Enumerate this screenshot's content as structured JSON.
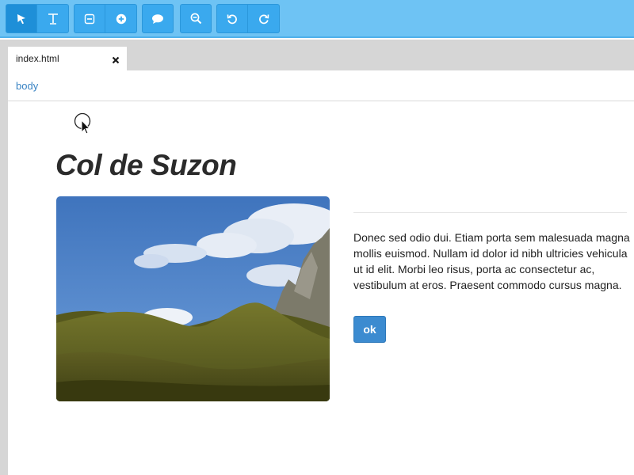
{
  "toolbar": {
    "buttons": [
      {
        "name": "select-tool",
        "icon": "pointer-arrow-icon",
        "active": true
      },
      {
        "name": "text-tool",
        "icon": "text-cursor-icon"
      },
      {
        "name": "remove-element",
        "icon": "minus-square-icon"
      },
      {
        "name": "add-element",
        "icon": "plus-circle-icon"
      },
      {
        "name": "comment",
        "icon": "speech-bubble-icon"
      },
      {
        "name": "zoom-out",
        "icon": "zoom-out-icon"
      },
      {
        "name": "undo",
        "icon": "undo-icon"
      },
      {
        "name": "redo",
        "icon": "redo-icon"
      }
    ],
    "colors": {
      "bar": "#6ec3f4",
      "button": "#3aa9ee",
      "active": "#1e8fd8"
    }
  },
  "tab": {
    "label": "index.html",
    "close_icon": "close-x-icon"
  },
  "breadcrumb": {
    "label": "body"
  },
  "content": {
    "heading": "Col de Suzon",
    "image_alt": "mountain landscape photo",
    "paragraph": "Donec sed odio dui. Etiam porta sem malesuada magna mollis euismod. Nullam id dolor id nibh ultricies vehicula ut id elit. Morbi leo risus, porta ac consectetur ac, vestibulum at eros. Praesent commodo cursus magna.",
    "button_label": "ok"
  }
}
